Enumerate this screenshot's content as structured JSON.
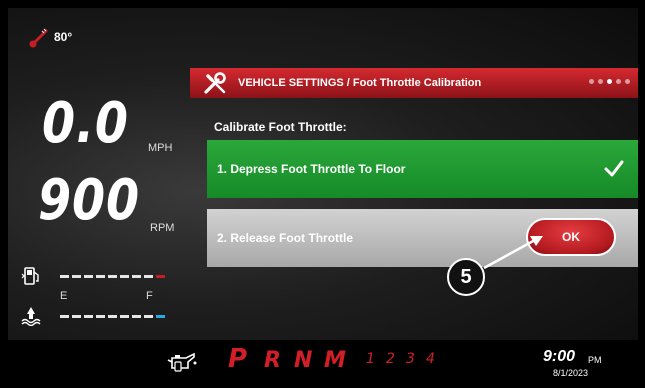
{
  "status": {
    "temperature": "80°",
    "temperature_icon": "thermometer-icon"
  },
  "gauges": {
    "speed_value": "0.0",
    "speed_unit": "MPH",
    "rpm_value": "900",
    "rpm_unit": "RPM",
    "fuel_icon": "fuel-pump-icon",
    "coolant_icon": "coolant-icon",
    "coolant_empty_label": "E",
    "coolant_full_label": "F"
  },
  "panel": {
    "header_icon": "wrench-screwdriver-icon",
    "breadcrumb": "VEHICLE SETTINGS / Foot Throttle Calibration",
    "page_dots": 5,
    "active_dot": 3,
    "subtitle": "Calibrate Foot Throttle:",
    "step1_label": "1. Depress Foot Throttle To Floor",
    "step1_status_icon": "checkmark-icon",
    "step2_label": "2. Release Foot Throttle",
    "ok_button_label": "OK",
    "callout_number": "5"
  },
  "bottom_bar": {
    "oil_icon": "oil-can-icon",
    "gears": [
      "P",
      "R",
      "N",
      "M",
      "1",
      "2",
      "3",
      "4"
    ],
    "time": "9:00",
    "ampm": "PM",
    "date": "8/1/2023"
  },
  "colors": {
    "accent_red": "#c41d25",
    "step_complete_green": "#1f9a30",
    "coolant_blue": "#29a9e0"
  }
}
